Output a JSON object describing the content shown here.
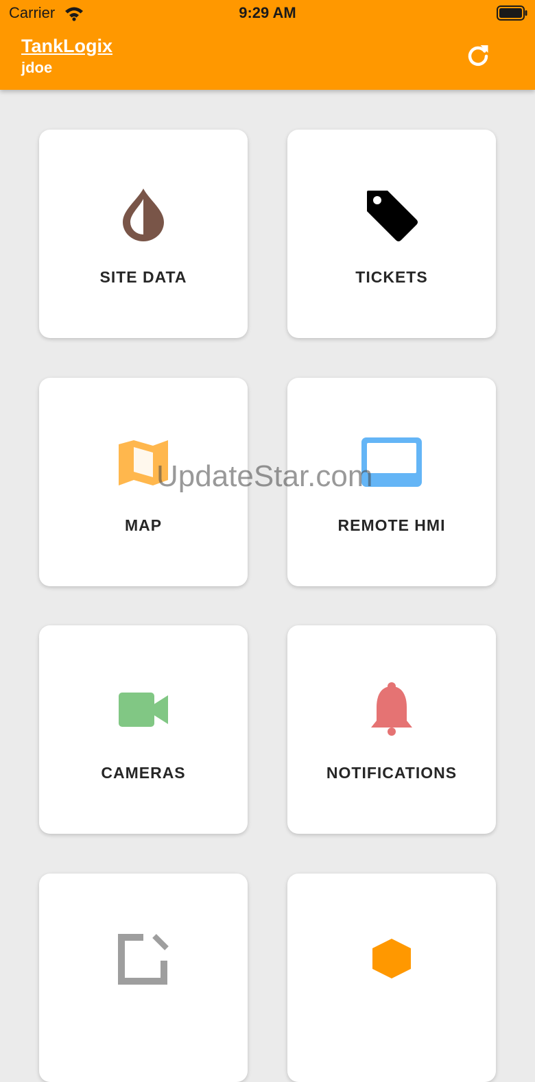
{
  "status_bar": {
    "carrier": "Carrier",
    "time": "9:29 AM"
  },
  "header": {
    "title": "TankLogix",
    "user": "jdoe",
    "refresh_icon": "refresh-icon"
  },
  "tiles": [
    {
      "label": "SITE DATA",
      "icon": "drop-icon",
      "color": "#795548"
    },
    {
      "label": "TICKETS",
      "icon": "tag-icon",
      "color": "#000000"
    },
    {
      "label": "MAP",
      "icon": "map-icon",
      "color": "#ffb74d"
    },
    {
      "label": "REMOTE HMI",
      "icon": "monitor-icon",
      "color": "#64b5f6"
    },
    {
      "label": "CAMERAS",
      "icon": "video-camera-icon",
      "color": "#81c784"
    },
    {
      "label": "NOTIFICATIONS",
      "icon": "bell-icon",
      "color": "#e57373"
    },
    {
      "label": "",
      "icon": "edit-icon",
      "color": "#9e9e9e"
    },
    {
      "label": "",
      "icon": "hexagon-icon",
      "color": "#ff9800"
    }
  ],
  "watermark": "UpdateStar.com",
  "colors": {
    "header": "#ff9800",
    "background": "#ebebeb"
  }
}
